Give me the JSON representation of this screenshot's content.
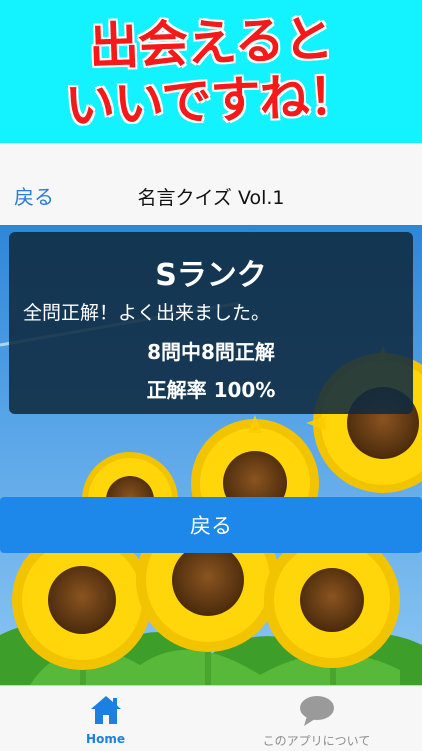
{
  "banner": {
    "line1": "出会えると",
    "line2": "いいですね！"
  },
  "navbar": {
    "back_label": "戻る",
    "title": "名言クイズ Vol.1"
  },
  "result": {
    "rank": "Sランク",
    "message": "全問正解！よく出来ました。",
    "score": "8問中8問正解",
    "rate": "正解率 100%"
  },
  "back_button": {
    "label": "戻る"
  },
  "tabbar": {
    "home": {
      "label": "Home",
      "icon": "home-icon"
    },
    "about": {
      "label": "このアプリについて",
      "icon": "speech-bubble-icon"
    }
  },
  "colors": {
    "banner_bg": "#13f2ff",
    "banner_text": "#f41a1a",
    "accent": "#1e88ea",
    "panel_bg": "#0f2a40"
  }
}
